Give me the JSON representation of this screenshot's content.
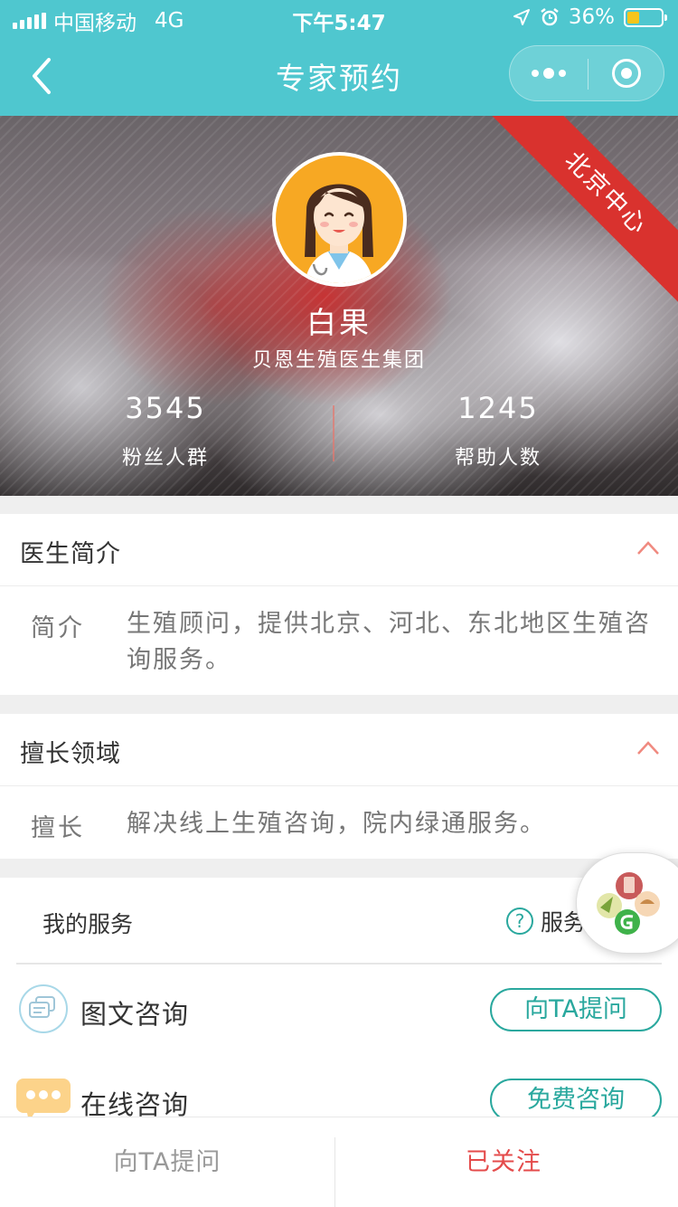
{
  "status_bar": {
    "carrier": "中国移动",
    "network": "4G",
    "time": "下午5:47",
    "battery": "36%",
    "battery_level": 0.36
  },
  "nav": {
    "title": "专家预约",
    "icons": [
      "chevron-left-icon",
      "more-dots-icon",
      "target-icon"
    ]
  },
  "doctor": {
    "name": "白果",
    "organization": "贝恩生殖医生集团",
    "badge": "北京中心",
    "badge_color": "#d9322e",
    "stats": [
      {
        "value": "3545",
        "label": "粉丝人群"
      },
      {
        "value": "1245",
        "label": "帮助人数"
      }
    ]
  },
  "intro": {
    "title": "医生简介",
    "label": "简介",
    "text": "生殖顾问，提供北京、河北、东北地区生殖咨询服务。"
  },
  "expertise": {
    "title": "擅长领域",
    "label": "擅长",
    "text": "解决线上生殖咨询，院内绿通服务。"
  },
  "services": {
    "title": "我的服务",
    "help_label": "服务",
    "items": [
      {
        "label": "图文咨询",
        "action": "向TA提问",
        "icon": "chat-bubbles-icon"
      },
      {
        "label": "在线咨询",
        "action": "免费咨询",
        "icon": "speech-dots-icon"
      }
    ]
  },
  "bottom_bar": {
    "ask": "向TA提问",
    "follow": "已关注"
  },
  "colors": {
    "header": "#4fc7cf",
    "accent": "#2aa89e",
    "follow": "#e44b4b",
    "chevron": "#f08a80"
  }
}
